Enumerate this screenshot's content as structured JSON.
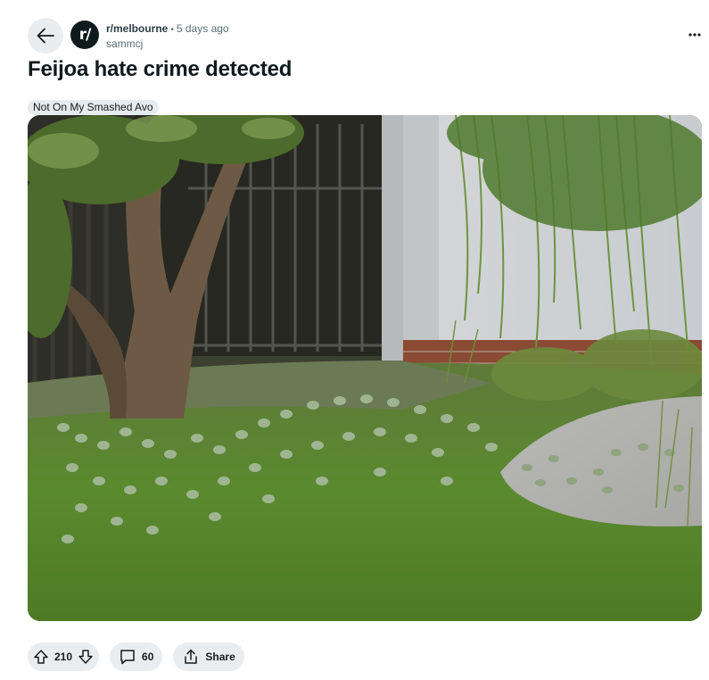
{
  "post": {
    "subreddit": "r/melbourne",
    "subreddit_icon_text": "r/",
    "separator": "•",
    "time_ago": "5 days ago",
    "author": "sammcj",
    "title": "Feijoa hate crime detected",
    "flair": "Not On My Smashed Avo"
  },
  "actions": {
    "score": "210",
    "comments": "60",
    "share_label": "Share"
  },
  "icons": {
    "back": "arrow-left-icon",
    "more": "ellipsis-icon",
    "upvote": "arrow-up-icon",
    "downvote": "arrow-down-icon",
    "comment": "speech-bubble-icon",
    "share": "share-icon"
  },
  "colors": {
    "pill_bg": "#eaedef",
    "flair_bg": "#e5ebee",
    "avatar_bg": "#0f1a1c",
    "meta_text": "#576f76"
  }
}
